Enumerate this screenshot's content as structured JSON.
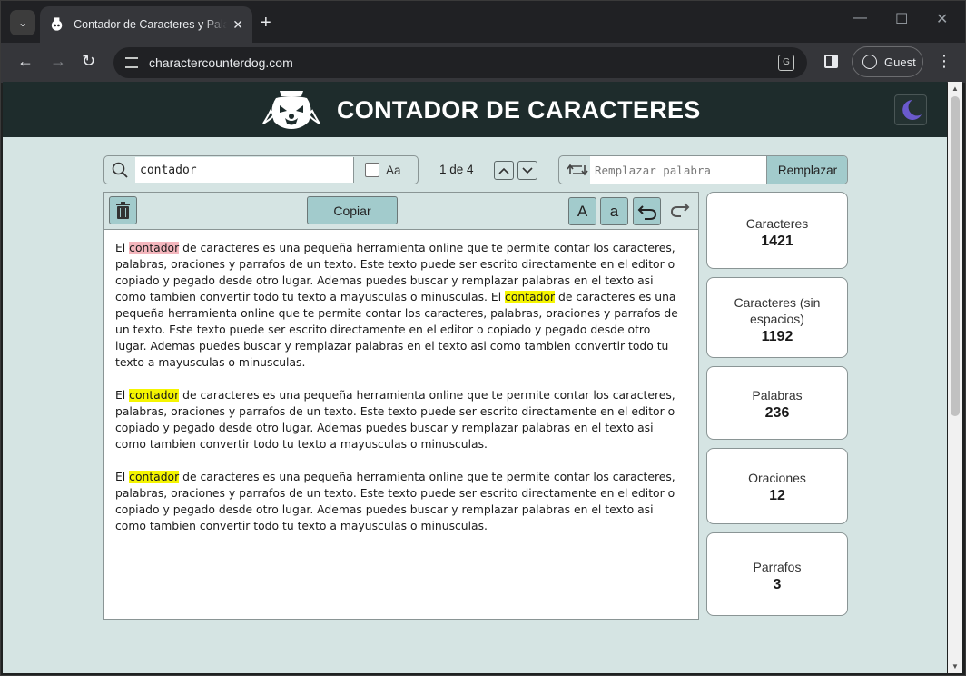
{
  "browser": {
    "tab_title": "Contador de Caracteres y Palab",
    "url": "charactercounterdog.com",
    "guest_label": "Guest"
  },
  "site": {
    "title": "CONTADOR DE CARACTERES"
  },
  "search": {
    "value": "contador",
    "case_label": "Aa",
    "match_count": "1 de 4"
  },
  "replace": {
    "placeholder": "Remplazar palabra",
    "button_label": "Remplazar"
  },
  "editor": {
    "copy_label": "Copiar",
    "upper_label": "A",
    "lower_label": "a",
    "paragraphs": [
      {
        "segments": [
          {
            "t": "El "
          },
          {
            "t": "contador",
            "h": "current"
          },
          {
            "t": " de caracteres es una pequeña herramienta online que te permite contar los caracteres, palabras, oraciones y parrafos de un texto. Este texto puede ser escrito directamente en el editor o copiado y pegado desde otro lugar. Ademas puedes buscar y remplazar palabras en el texto asi como tambien convertir todo tu texto a mayusculas o minusculas. El "
          },
          {
            "t": "contador",
            "h": "match"
          },
          {
            "t": " de caracteres es una pequeña herramienta online que te permite contar los caracteres, palabras, oraciones y parrafos de un texto. Este texto puede ser escrito directamente en el editor o copiado y pegado desde otro lugar. Ademas puedes buscar y remplazar palabras en el texto asi como tambien convertir todo tu texto a mayusculas o minusculas."
          }
        ]
      },
      {
        "segments": [
          {
            "t": "El "
          },
          {
            "t": "contador",
            "h": "match"
          },
          {
            "t": " de caracteres es una pequeña herramienta online que te permite contar los caracteres, palabras, oraciones y parrafos de un texto. Este texto puede ser escrito directamente en el editor o copiado y pegado desde otro lugar. Ademas puedes buscar y remplazar palabras en el texto asi como tambien convertir todo tu texto a mayusculas o minusculas."
          }
        ]
      },
      {
        "segments": [
          {
            "t": "El "
          },
          {
            "t": "contador",
            "h": "match"
          },
          {
            "t": " de caracteres es una pequeña herramienta online que te permite contar los caracteres, palabras, oraciones y parrafos de un texto. Este texto puede ser escrito directamente en el editor o copiado y pegado desde otro lugar. Ademas puedes buscar y remplazar palabras en el texto asi como tambien convertir todo tu texto a mayusculas o minusculas."
          }
        ]
      }
    ]
  },
  "stats": [
    {
      "label": "Caracteres",
      "value": "1421"
    },
    {
      "label": "Caracteres (sin espacios)",
      "value": "1192"
    },
    {
      "label": "Palabras",
      "value": "236"
    },
    {
      "label": "Oraciones",
      "value": "12"
    },
    {
      "label": "Parrafos",
      "value": "3"
    }
  ],
  "colors": {
    "page_bg": "#d5e4e3",
    "header_bg": "#1e2c2c",
    "button_bg": "#a2cbcc",
    "match_highlight": "#f5f500",
    "current_match_highlight": "#f4b6bd"
  }
}
